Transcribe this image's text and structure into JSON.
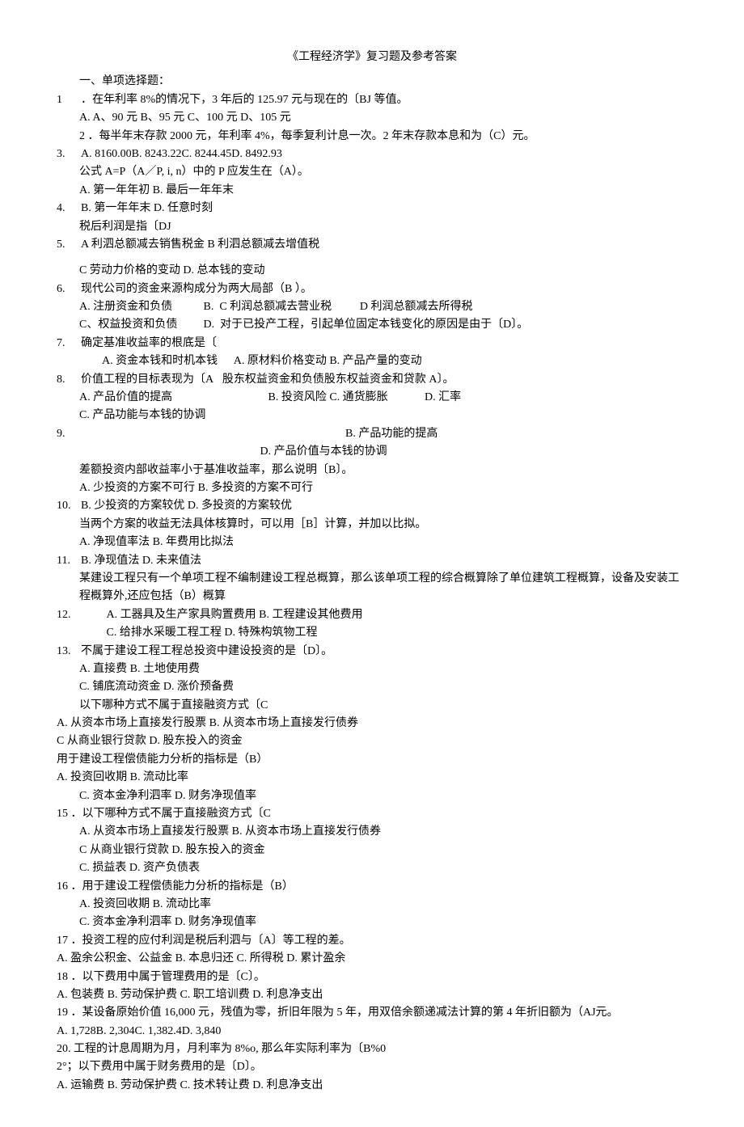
{
  "title": "《工程经济学》复习题及参考答案",
  "section1_head": "一、单项选择题：",
  "q1": {
    "num": "1",
    "text": "．在年利率 8%的情况下，3 年后的 125.97 元与现在的〔BJ 等值。",
    "opts": "A. A、90 元 B、95 元 C、100 元 D、105 元"
  },
  "q2": {
    "num": "2",
    "text": "．每半年末存款 2000 元，年利率 4%，每季复利计息一次。2 年末存款本息和为（C）元。",
    "opts": "A. 8160.00B. 8243.22C. 8244.45D. 8492.93"
  },
  "q3": {
    "num": "3.",
    "text": "公式 A=P（A／P, i, n）中的 P 应发生在（A）。",
    "opts1": "A. 第一年年初 B. 最后一年年末",
    "opts2": "B. 第一年年末 D. 任意时刻"
  },
  "q4": {
    "num": "4.",
    "text": "税后利润是指〔DJ",
    "opts1": "A 利泗总额减去销售税金    B 利泗总额减去增值税"
  },
  "q5": {
    "num": "5.",
    "opts1": "C 劳动力价格的变动 D. 总本钱的变动"
  },
  "q6": {
    "num": "6.",
    "text": "现代公司的资金来源构成分为两大局部（B ）。",
    "l1a": "A. 注册资金和负债",
    "l1b": "B.",
    "l1c": "C 利润总额减去营业税",
    "l1d": "D 利润总额减去所得税",
    "l2a": "C、权益投资和负债",
    "l2b": "D.",
    "l2c": "对于已投产工程，引起单位固定本钱变化的原因是由于〔D〕。"
  },
  "q7": {
    "num": "7.",
    "text": "确定基准收益率的根底是〔",
    "l1a": "A. 资金本钱和时机本钱",
    "l1b": "A. 原材料价格变动 B. 产品产量的变动",
    "l2": "股东权益资金和负债股东权益资金和贷款 A〕。"
  },
  "q8": {
    "num": "8.",
    "text": "价值工程的目标表现为〔A",
    "l1a": "A. 产品价值的提高",
    "l1b": "B. 投资风险 C. 通货膨胀",
    "l1c": "D. 汇率",
    "l2a": "C. 产品功能与本钱的协调",
    "l3b": "B. 产品功能的提高"
  },
  "q9": {
    "num": "9.",
    "l1b": "D. 产品价值与本钱的协调",
    "text": "差额投资内部收益率小于基准收益率，那么说明〔B〕。",
    "opts1": "A. 少投资的方案不可行 B. 多投资的方案不可行"
  },
  "q10": {
    "num": "10.",
    "opts2": "B. 少投资的方案较优 D. 多投资的方案较优",
    "text": "当两个方案的收益无法具体核算时，可以用［B］计算，并加以比拟。",
    "opts3": "A. 净现值率法    B. 年费用比拟法"
  },
  "q11": {
    "num": "11.",
    "opts4": "B. 净现值法    D. 未来值法",
    "text": "某建设工程只有一个单项工程不编制建设工程总概算，那么该单项工程的综合概算除了单位建筑工程概算，设备及安装工程概算外,还应包括（B）概算"
  },
  "q12": {
    "num": "12.",
    "l1": "A. 工器具及生产家具购置费用 B. 工程建设其他费用",
    "l2": "C. 给排水采暖工程工程        D. 特殊构筑物工程"
  },
  "q13": {
    "num": "13.",
    "text": "不属于建设工程工程总投资中建设投资的是〔D〕。",
    "l1": "A. 直接费        B. 土地使用费",
    "l2": "C. 铺底流动资金    D. 涨价预备费",
    "l3": "以下哪种方式不属于直接融资方式〔C"
  },
  "p14a": "A. 从资本市场上直接发行股票 B. 从资本市场上直接发行债券",
  "p14b": "C 从商业银行贷款                D. 股东投入的资金",
  "p14c": "用于建设工程偿债能力分析的指标是（B）",
  "p14d": "A. 投资回收期        B. 流动比率",
  "p14e": "C. 资本金净利泗率 D. 财务净现值率",
  "q15": {
    "num": "15",
    "text": "．以下哪种方式不属于直接融资方式〔C",
    "l1": "A. 从资本市场上直接发行股票    B. 从资本市场上直接发行债券",
    "l2": "C 从商业银行贷款                D. 股东投入的资金",
    "l3": "C. 损益表 D. 资产负债表"
  },
  "q16": {
    "num": "16",
    "text": "．用于建设工程偿债能力分析的指标是（B）",
    "l1": "A. 投资回收期        B. 流动比率",
    "l2": "C. 资本金净利泗率 D. 财务净现值率"
  },
  "q17": {
    "num": "17",
    "text": "．投资工程的应付利润是税后利泗与〔A〕等工程的差。",
    "l1": "A. 盈余公积金、公益金 B. 本息归还 C. 所得税 D. 累计盈余"
  },
  "q18": {
    "num": "18",
    "text": "．以下费用中属于管理费用的是〔C〕。",
    "l1": "A. 包装费    B. 劳动保护费        C. 职工培训费 D. 利息净支出"
  },
  "q19": {
    "num": "19",
    "text": "．某设备原始价值 16,000 元，残值为零，折旧年限为 5 年，用双倍余额递减法计算的第 4 年折旧额为（AJ元。",
    "l1": "A. 1,728B. 2,304C. 1,382.4D. 3,840"
  },
  "q20": {
    "text": "20. 工程的计息周期为月，月利率为 8%o, 那么年实际利率为〔B%0",
    "l1": "2°；以下费用中属于财务费用的是〔D〕。",
    "l2": "A. 运输费 B. 劳动保护费 C. 技术转让费 D. 利息净支出"
  }
}
